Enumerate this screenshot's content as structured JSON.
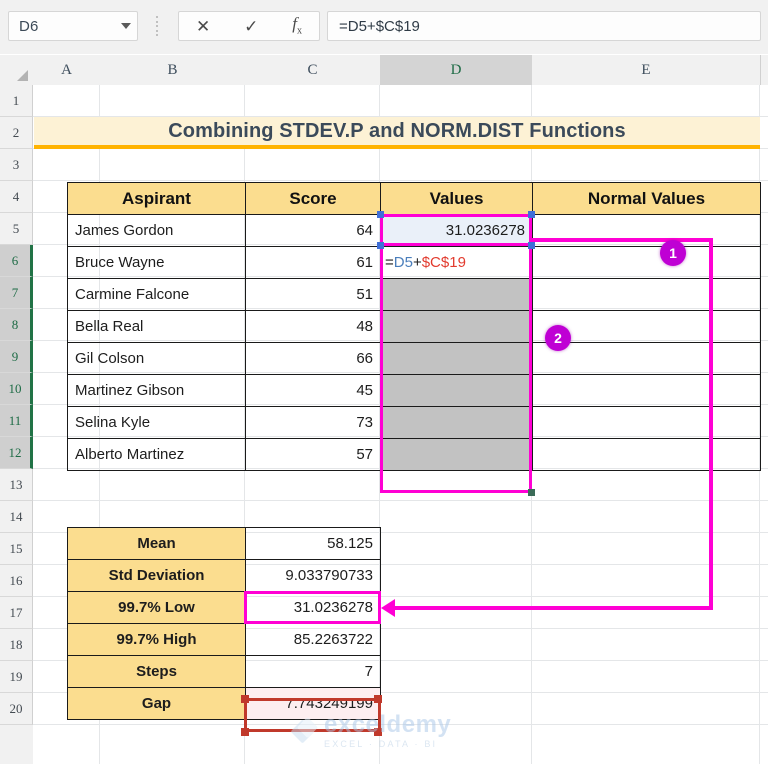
{
  "formula_bar": {
    "name_box_value": "D6",
    "dropdown_icon": "chevron-down-icon",
    "cancel_icon": "✕",
    "enter_icon": "✓",
    "function_icon": "fx",
    "formula_value": "=D5+$C$19"
  },
  "columns": [
    "A",
    "B",
    "C",
    "D",
    "E"
  ],
  "active_column": "D",
  "rows": [
    "1",
    "2",
    "3",
    "4",
    "5",
    "6",
    "7",
    "8",
    "9",
    "10",
    "11",
    "12",
    "13",
    "14",
    "15",
    "16",
    "17",
    "18",
    "19",
    "20"
  ],
  "selected_rows": [
    "6",
    "7",
    "8",
    "9",
    "10",
    "11",
    "12"
  ],
  "banner": {
    "title": "Combining STDEV.P and NORM.DIST Functions"
  },
  "table": {
    "headers": [
      "Aspirant",
      "Score",
      "Values",
      "Normal Values"
    ],
    "rows": [
      {
        "aspirant": "James Gordon",
        "score": "64",
        "value": "31.0236278",
        "normal": ""
      },
      {
        "aspirant": "Bruce Wayne",
        "score": "61",
        "value": "",
        "normal": ""
      },
      {
        "aspirant": "Carmine Falcone",
        "score": "51",
        "value": "",
        "normal": ""
      },
      {
        "aspirant": "Bella Real",
        "score": "48",
        "value": "",
        "normal": ""
      },
      {
        "aspirant": "Gil Colson",
        "score": "66",
        "value": "",
        "normal": ""
      },
      {
        "aspirant": "Martinez Gibson",
        "score": "45",
        "value": "",
        "normal": ""
      },
      {
        "aspirant": "Selina Kyle",
        "score": "73",
        "value": "",
        "normal": ""
      },
      {
        "aspirant": "Alberto Martinez",
        "score": "57",
        "value": "",
        "normal": ""
      }
    ],
    "editing_cell": {
      "row_index": 1,
      "formula_prefix": "=",
      "formula_ref1": "D5",
      "formula_operator": "+",
      "formula_ref2": "$C$19"
    }
  },
  "summary": {
    "rows": [
      {
        "label": "Mean",
        "value": "58.125"
      },
      {
        "label": "Std Deviation",
        "value": "9.033790733"
      },
      {
        "label": "99.7% Low",
        "value": "31.0236278"
      },
      {
        "label": "99.7% High",
        "value": "85.2263722"
      },
      {
        "label": "Steps",
        "value": "7"
      },
      {
        "label": "Gap",
        "value": "7.743249199"
      }
    ]
  },
  "annotations": {
    "badges": [
      {
        "label": "1"
      },
      {
        "label": "2"
      }
    ],
    "accent_magenta": "#ff00d4",
    "accent_red": "#c0392b",
    "arrow_icon": "arrow-left-icon"
  },
  "watermark": {
    "name": "exceldemy",
    "tagline": "EXCEL · DATA · BI"
  }
}
